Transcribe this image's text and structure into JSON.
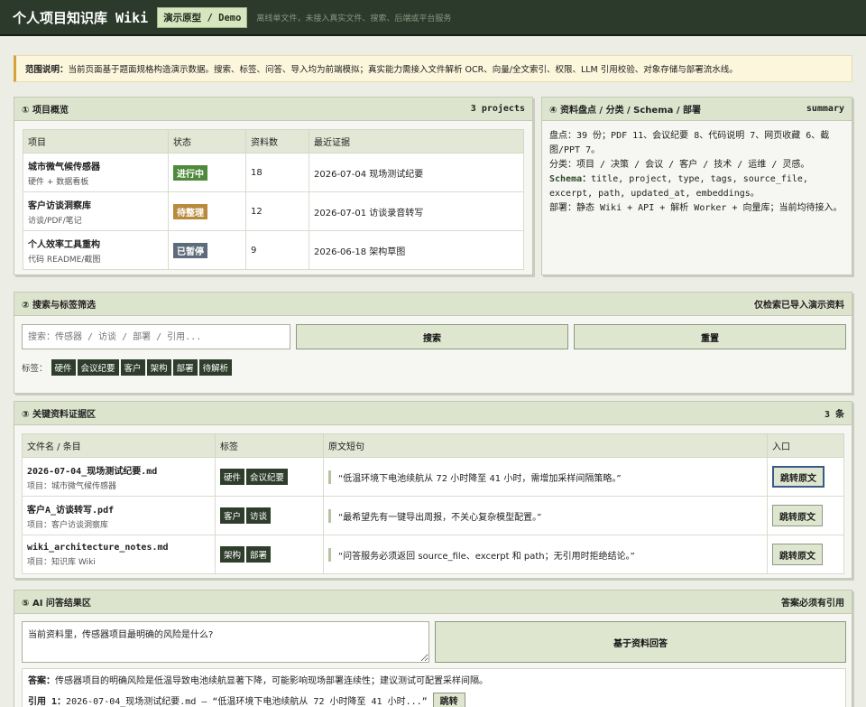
{
  "header": {
    "title": "个人项目知识库 Wiki",
    "badge": "演示原型 / Demo",
    "hint": "离线单文件，未接入真实文件、搜索、后端或平台服务"
  },
  "notice": {
    "label": "范围说明：",
    "text": "当前页面基于题面规格构造演示数据。搜索、标签、问答、导入均为前端模拟；真实能力需接入文件解析 OCR、向量/全文索引、权限、LLM 引用校验、对象存储与部署流水线。"
  },
  "overview": {
    "title": "① 项目概览",
    "count": "3 projects",
    "columns": [
      "项目",
      "状态",
      "资料数",
      "最近证据"
    ],
    "rows": [
      {
        "name": "城市微气候传感器",
        "sub": "硬件 + 数据看板",
        "status": "进行中",
        "status_color": "#4f8a3c",
        "count": "18",
        "evidence": "2026-07-04 现场测试纪要"
      },
      {
        "name": "客户访谈洞察库",
        "sub": "访谈/PDF/笔记",
        "status": "待整理",
        "status_color": "#b98a3e",
        "count": "12",
        "evidence": "2026-07-01 访谈录音转写"
      },
      {
        "name": "个人效率工具重构",
        "sub": "代码 README/截图",
        "status": "已暂停",
        "status_color": "#5f6b7a",
        "count": "9",
        "evidence": "2026-06-18 架构草图"
      }
    ]
  },
  "summary": {
    "title": "④ 资料盘点 / 分类 / Schema / 部署",
    "right": "summary",
    "inventory_label": "盘点：",
    "inventory": "39 份；PDF 11、会议纪要 8、代码说明 7、网页收藏 6、截图/PPT 7。",
    "category_label": "分类：",
    "category": "项目 / 决策 / 会议 / 客户 / 技术 / 运维 / 灵感。",
    "schema_label": "Schema：",
    "schema": "title, project, type, tags, source_file, excerpt, path, updated_at, embeddings。",
    "deploy_label": "部署：",
    "deploy": "静态 Wiki + API + 解析 Worker + 向量库；当前均待接入。"
  },
  "search": {
    "title": "② 搜索与标签筛选",
    "right": "仅检索已导入演示资料",
    "placeholder": "搜索：传感器 / 访谈 / 部署 / 引用...",
    "search_label": "搜索",
    "reset_label": "重置",
    "tags_label": "标签：",
    "tags": [
      "硬件",
      "会议纪要",
      "客户",
      "架构",
      "部署",
      "待解析"
    ]
  },
  "evidence": {
    "title": "③ 关键资料证据区",
    "count": "3 条",
    "columns": [
      "文件名 / 条目",
      "标签",
      "原文短句",
      "入口"
    ],
    "rows": [
      {
        "file": "2026-07-04_现场测试纪要.md",
        "project": "项目：城市微气候传感器",
        "tags": [
          "硬件",
          "会议纪要"
        ],
        "quote": "“低温环境下电池续航从 72 小时降至 41 小时，需增加采样间隔策略。”",
        "action": "跳转原文"
      },
      {
        "file": "客户A_访谈转写.pdf",
        "project": "项目：客户访谈洞察库",
        "tags": [
          "客户",
          "访谈"
        ],
        "quote": "“最希望先有一键导出周报，不关心复杂模型配置。”",
        "action": "跳转原文"
      },
      {
        "file": "wiki_architecture_notes.md",
        "project": "项目：知识库 Wiki",
        "tags": [
          "架构",
          "部署"
        ],
        "quote": "“问答服务必须返回 source_file、excerpt 和 path；无引用时拒绝结论。”",
        "action": "跳转原文"
      }
    ]
  },
  "qa": {
    "title": "⑤ AI 问答结果区",
    "right": "答案必须有引用",
    "question": "当前资料里，传感器项目最明确的风险是什么?",
    "ask_label": "基于资料回答",
    "answer_label": "答案：",
    "answer": "传感器项目的明确风险是低温导致电池续航显著下降，可能影响现场部署连续性；建议测试可配置采样间隔。",
    "cite_label": "引用 1：",
    "cite": "2026-07-04_现场测试纪要.md — “低温环境下电池续航从 72 小时降至 41 小时...”",
    "jump_label": "跳转"
  }
}
